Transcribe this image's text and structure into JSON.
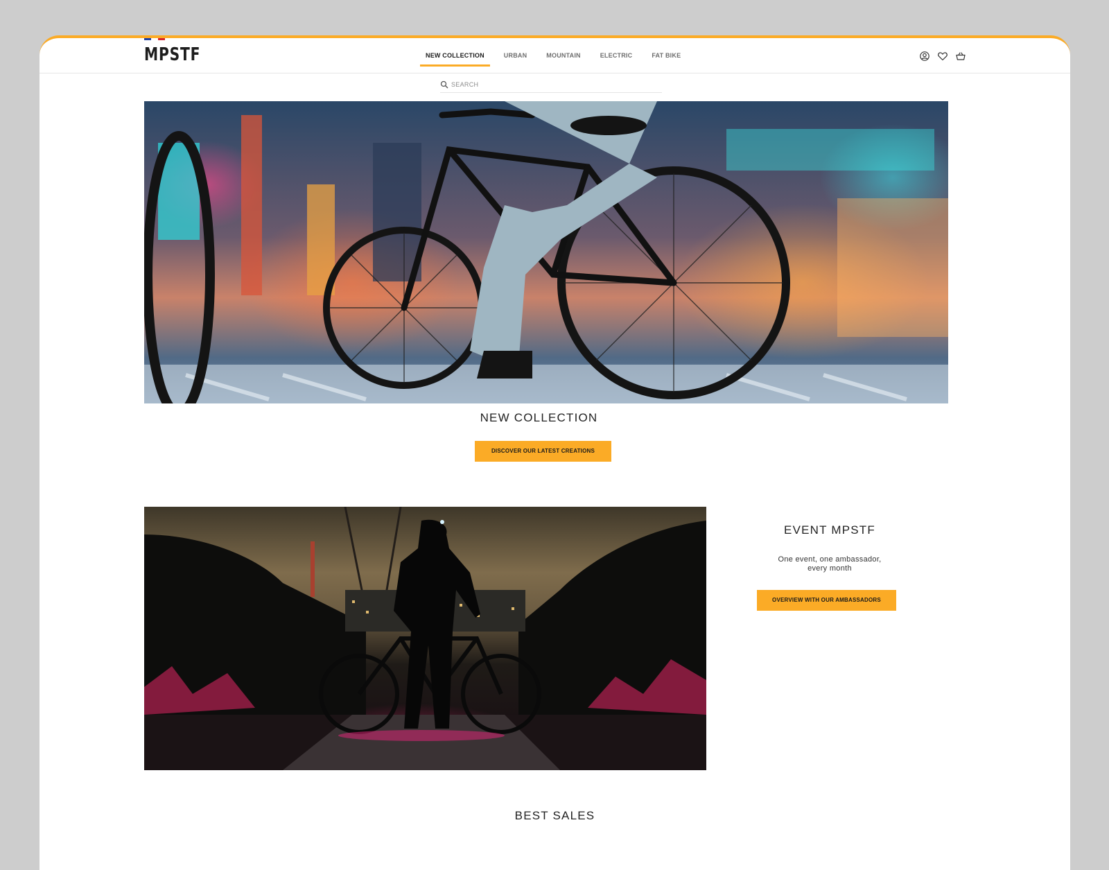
{
  "brand": {
    "logo": "MPSTF",
    "accent": "#fbab26",
    "flag_colors": [
      "#1d3fa5",
      "#ffffff",
      "#d8232a"
    ]
  },
  "nav": {
    "items": [
      {
        "label": "NEW COLLECTION",
        "active": true
      },
      {
        "label": "URBAN",
        "active": false
      },
      {
        "label": "MOUNTAIN",
        "active": false
      },
      {
        "label": "ELECTRIC",
        "active": false
      },
      {
        "label": "FAT BIKE",
        "active": false
      }
    ]
  },
  "header_icons": [
    "account-icon",
    "heart-icon",
    "basket-icon"
  ],
  "search": {
    "placeholder": "SEARCH",
    "value": ""
  },
  "hero": {
    "title": "NEW COLLECTION",
    "cta_label": "DISCOVER OUR LATEST CREATIONS"
  },
  "event": {
    "title": "EVENT MPSTF",
    "description_line1": "One event, one ambassador,",
    "description_line2": "every month",
    "cta_label": "OVERVIEW WITH OUR AMBASSADORS"
  },
  "best_sales": {
    "title": "BEST SALES"
  }
}
